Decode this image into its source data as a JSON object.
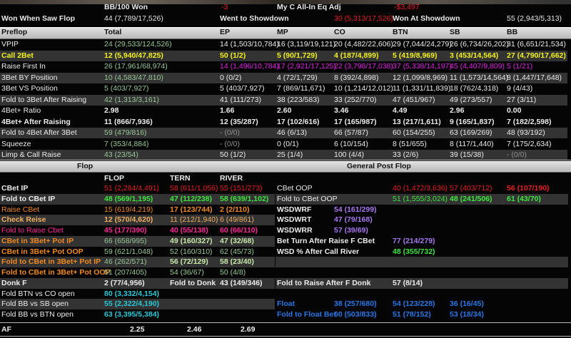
{
  "summary": {
    "bb100_label": "BB/100  Won",
    "bb100_value": "-3",
    "allin_label": "My C All-In Eq Adj",
    "allin_value": "-$3,497",
    "wwsf_label": "Won When Saw Flop",
    "wwsf_value": "44 (7,789/17,526)",
    "wtsd_label": "Went to Showdown",
    "wtsd_value": "30 (5,313/17,526)",
    "wsd_label": "Won At Showdown",
    "wsd_value": "55 (2,943/5,313)"
  },
  "colors": {
    "white": "#ececec",
    "green": "#98c898",
    "yellow": "#f2f21c",
    "magenta": "#e020e0",
    "red": "#e82020",
    "bright_green": "#3ee83e",
    "orange": "#f08a20",
    "light_orange": "#f0b060",
    "pink": "#ff2898",
    "purple": "#a878f0",
    "cyan": "#28c8d8",
    "blue": "#2a78e8",
    "gray": "#909090",
    "light_green": "#c8e8a8"
  },
  "preflop": {
    "headers": [
      "Preflop",
      "Total",
      "EP",
      "MP",
      "CO",
      "BTN",
      "SB",
      "BB"
    ],
    "rows": [
      {
        "label": "VPIP",
        "lc": "white",
        "bold": false,
        "vals": [
          "24 (29,533/124,526)",
          "14 (1,503/10,784)",
          "16 (3,119/19,121)",
          "20 (4,482/22,606)",
          "29 (7,044/24,279)",
          "26 (6,734/26,202)",
          "31 (6,651/21,534)"
        ],
        "vc": [
          "green",
          "white",
          "white",
          "white",
          "white",
          "white",
          "white"
        ]
      },
      {
        "label": "Call 2Bet",
        "lc": "yellow",
        "bold": true,
        "vals": [
          "12 (5,940/47,825)",
          "50 (1/2)",
          "5 (90/1,729)",
          "4 (187/4,899)",
          "5 (419/8,969)",
          "3 (453/14,564)",
          "27 (4,790/17,662)"
        ],
        "vc": [
          "yellow",
          "yellow",
          "yellow",
          "yellow",
          "yellow",
          "yellow",
          "yellow"
        ]
      },
      {
        "label": "Raise First In",
        "lc": "white",
        "bold": false,
        "vals": [
          "26 (17,961/68,974)",
          "14 (1,496/10,784)",
          "17 (2,921/17,125)",
          "22 (3,798/17,038)",
          "37 (5,338/14,197)",
          "45 (4,407/9,809)",
          "5 (1/21)"
        ],
        "vc": [
          "green",
          "magenta",
          "magenta",
          "magenta",
          "magenta",
          "magenta",
          "magenta"
        ]
      },
      {
        "label": "3Bet BY Position",
        "lc": "white",
        "bold": false,
        "vals": [
          "10 (4,583/47,810)",
          "0 (0/2)",
          "4 (72/1,729)",
          "8 (392/4,898)",
          "12 (1,099/8,969)",
          "11 (1,573/14,564)",
          "8 (1,447/17,648)"
        ],
        "vc": [
          "green",
          "white",
          "white",
          "white",
          "white",
          "white",
          "white"
        ]
      },
      {
        "label": "3Bet VS Position",
        "lc": "white",
        "bold": false,
        "vals": [
          "5 (403/7,927)",
          "5 (403/7,927)",
          "7 (869/11,671)",
          "10 (1,214/12,012)",
          "11 (1,331/11,839)",
          "18 (762/4,318)",
          "9 (4/43)"
        ],
        "vc": [
          "green",
          "white",
          "white",
          "white",
          "white",
          "white",
          "white"
        ]
      },
      {
        "label": "Fold to 3Bet After Raising",
        "lc": "white",
        "bold": false,
        "vals": [
          "42 (1,313/3,161)",
          "41 (111/273)",
          "38 (223/583)",
          "33 (252/770)",
          "47 (451/967)",
          "49 (273/557)",
          "27 (3/11)"
        ],
        "vc": [
          "green",
          "white",
          "white",
          "white",
          "white",
          "white",
          "white"
        ]
      },
      {
        "label": "4Bet+ Ratio",
        "lc": "white",
        "bold": false,
        "vals": [
          "2.98",
          "1.66",
          "2.60",
          "3.46",
          "4.49",
          "2.96",
          "0.00"
        ],
        "vc": [
          "white",
          "white",
          "white",
          "white",
          "white",
          "white",
          "white"
        ],
        "vbold": true
      },
      {
        "label": "4Bet+ After Raising",
        "lc": "white",
        "bold": true,
        "vals": [
          "11 (866/7,936)",
          "12 (35/287)",
          "17 (102/616)",
          "17 (165/987)",
          "13 (217/1,611)",
          "9 (165/1,837)",
          "7 (182/2,598)"
        ],
        "vc": [
          "white",
          "white",
          "white",
          "white",
          "white",
          "white",
          "white"
        ],
        "vbold": true
      },
      {
        "label": "Fold to 4Bet After 3Bet",
        "lc": "white",
        "bold": false,
        "vals": [
          "59 (479/816)",
          "- (0/0)",
          "46 (6/13)",
          "66 (57/87)",
          "60 (154/255)",
          "63 (169/269)",
          "48 (93/192)"
        ],
        "vc": [
          "green",
          "gray",
          "white",
          "white",
          "white",
          "white",
          "white"
        ]
      },
      {
        "label": "Squeeze",
        "lc": "white",
        "bold": false,
        "vals": [
          "7 (353/4,884)",
          "- (0/0)",
          "0 (0/1)",
          "6 (10/154)",
          "8 (51/655)",
          "8 (117/1,440)",
          "7 (175/2,634)"
        ],
        "vc": [
          "green",
          "gray",
          "white",
          "white",
          "white",
          "white",
          "white"
        ]
      },
      {
        "label": "Limp & Call Raise",
        "lc": "white",
        "bold": false,
        "vals": [
          "43 (23/54)",
          "50 (1/2)",
          "25 (1/4)",
          "100 (4/4)",
          "33 (2/6)",
          "39 (15/38)",
          "- (0/0)"
        ],
        "vc": [
          "green",
          "white",
          "white",
          "white",
          "white",
          "white",
          "gray"
        ]
      }
    ]
  },
  "sections": {
    "flop": "Flop",
    "general": "General Post Flop"
  },
  "flop": {
    "headers": [
      "FLOP",
      "TERN",
      "RIVER"
    ],
    "rows": [
      {
        "label": "CBet IP",
        "lc": "white",
        "bold": true,
        "vals": [
          "51 (2,284/4,491)",
          "58 (611/1,056)",
          "55 (151/273)"
        ],
        "vc": [
          "red",
          "red",
          "red"
        ],
        "vb": [
          false,
          false,
          false
        ]
      },
      {
        "label": "Fold to CBet IP",
        "lc": "white",
        "bold": true,
        "vals": [
          "48 (569/1,195)",
          "47 (112/238)",
          "58 (639/1,102)"
        ],
        "vc": [
          "bright_green",
          "bright_green",
          "bright_green"
        ],
        "vb": [
          true,
          true,
          true
        ]
      },
      {
        "label": "Raise CBet",
        "lc": "orange",
        "bold": false,
        "vals": [
          "15 (619/4,219)",
          "17 (123/744)",
          "2 (2/110)"
        ],
        "vc": [
          "orange",
          "orange",
          "orange"
        ],
        "vb": [
          false,
          true,
          true
        ]
      },
      {
        "label": "Check Reise",
        "lc": "light_orange",
        "bold": true,
        "vals": [
          "12 (570/4,620)",
          "11 (212/1,940)",
          "6 (49/861)"
        ],
        "vc": [
          "light_orange",
          "light_orange",
          "light_orange"
        ],
        "vb": [
          true,
          false,
          false
        ]
      },
      {
        "label": "Fold to Raise Cbet",
        "lc": "pink",
        "bold": false,
        "vals": [
          "45 (177/390)",
          "40 (55/138)",
          "60 (66/110)"
        ],
        "vc": [
          "pink",
          "pink",
          "pink"
        ],
        "vb": [
          true,
          true,
          true
        ]
      },
      {
        "label": "CBet in 3Bet+ Pot IP",
        "lc": "orange",
        "bold": true,
        "vals": [
          "66 (658/995)",
          "49 (160/327)",
          "47 (32/68)"
        ],
        "vc": [
          "green",
          "light_green",
          "light_green"
        ],
        "vb": [
          false,
          true,
          true
        ]
      },
      {
        "label": "CBet in 3Bet+ Pot OOP",
        "lc": "orange",
        "bold": true,
        "vals": [
          "59 (621/1,048)",
          "52 (160/310)",
          "62 (45/73)"
        ],
        "vc": [
          "green",
          "green",
          "green"
        ],
        "vb": [
          false,
          false,
          false
        ]
      },
      {
        "label": "Fold to CBet in 3Bet+ Pot IP",
        "lc": "orange",
        "bold": true,
        "vals": [
          "46 (262/571)",
          "56 (72/129)",
          "58 (23/40)"
        ],
        "vc": [
          "green",
          "light_green",
          "light_green"
        ],
        "vb": [
          false,
          true,
          true
        ]
      },
      {
        "label": "Fold to CBet in 3Bet+ Pot OOP",
        "lc": "orange",
        "bold": true,
        "vals": [
          "51 (207/405)",
          "54 (36/67)",
          "50 (4/8)"
        ],
        "vc": [
          "green",
          "green",
          "green"
        ],
        "vb": [
          false,
          false,
          false
        ]
      },
      {
        "label": "Donk F",
        "lc": "white",
        "bold": true,
        "vals": [
          "2 (77/4,956)",
          "Fold to Donk",
          "43 (149/346)"
        ],
        "vc": [
          "white",
          "white",
          "white"
        ],
        "vb": [
          true,
          true,
          true
        ]
      },
      {
        "label": "Fold BTN vs CO open",
        "lc": "white",
        "bold": false,
        "vals": [
          "80 (3,332/4,154)"
        ],
        "vc": [
          "cyan"
        ],
        "vb": [
          true
        ]
      },
      {
        "label": "Fold BB vs SB open",
        "lc": "white",
        "bold": false,
        "vals": [
          "55 (2,322/4,190)"
        ],
        "vc": [
          "cyan"
        ],
        "vb": [
          true
        ]
      },
      {
        "label": "Fold BB vs BTN open",
        "lc": "white",
        "bold": false,
        "vals": [
          "63 (3,395/5,384)"
        ],
        "vc": [
          "cyan"
        ],
        "vb": [
          true
        ]
      }
    ],
    "af": {
      "label": "AF",
      "vals": [
        "2.25",
        "2.46",
        "2.69"
      ]
    }
  },
  "general": {
    "rows": [
      {
        "label": "CBet OOP",
        "lc": "white",
        "bold": false,
        "vals": [
          null,
          "40 (1,472/3,636)",
          "57 (403/712)",
          "56 (107/190)"
        ],
        "vc": [
          null,
          "red",
          "red",
          "red"
        ],
        "vb": [
          false,
          false,
          false,
          true
        ]
      },
      {
        "label": "Fold to CBet OOP",
        "lc": "white",
        "bold": false,
        "gray": true,
        "vals": [
          null,
          "51 (1,555/3,024)",
          "48 (241/506)",
          "61 (43/70)"
        ],
        "vc": [
          null,
          "bright_green",
          "bright_green",
          "bright_green"
        ],
        "vb": [
          false,
          false,
          true,
          true
        ]
      },
      {
        "label": "WSDWRF",
        "lc": "white",
        "bold": true,
        "vals": [
          "54 (161/299)"
        ],
        "vc": [
          "purple"
        ],
        "vb": [
          true
        ]
      },
      {
        "label": "WSDWRT",
        "lc": "white",
        "bold": true,
        "vals": [
          "47 (79/168)"
        ],
        "vc": [
          "purple"
        ],
        "vb": [
          true
        ]
      },
      {
        "label": "WSDWRR",
        "lc": "white",
        "bold": true,
        "vals": [
          "57 (39/69)"
        ],
        "vc": [
          "purple"
        ],
        "vb": [
          true
        ]
      },
      {
        "label": "Bet Turn After Raise F CBet",
        "lc": "white",
        "bold": true,
        "vals": [
          null,
          "77 (214/279)"
        ],
        "vc": [
          null,
          "purple"
        ],
        "vb": [
          false,
          true
        ]
      },
      {
        "label": "WSD % After Call River",
        "lc": "white",
        "bold": true,
        "vals": [
          null,
          "48 (355/732)"
        ],
        "vc": [
          null,
          "bright_green"
        ],
        "vb": [
          false,
          true
        ]
      },
      {
        "gray": true
      },
      {},
      {
        "label": "Fold to Raise After F Donk",
        "lc": "white",
        "bold": true,
        "gray": true,
        "vals": [
          null,
          "57 (8/14)"
        ],
        "vc": [
          null,
          "white"
        ],
        "vb": [
          false,
          true
        ]
      },
      {},
      {
        "label": "Float",
        "lc": "blue",
        "bold": true,
        "vals": [
          "38 (257/680)",
          "54 (123/228)",
          "36 (16/45)"
        ],
        "vc": [
          "blue",
          "blue",
          "blue"
        ],
        "vb": [
          true,
          true,
          true
        ]
      },
      {
        "label": "Fold to Float Bet",
        "lc": "blue",
        "bold": true,
        "vals": [
          "60 (503/833)",
          "51 (78/152)",
          "53 (18/34)"
        ],
        "vc": [
          "blue",
          "blue",
          "blue"
        ],
        "vb": [
          true,
          true,
          true
        ]
      }
    ]
  }
}
